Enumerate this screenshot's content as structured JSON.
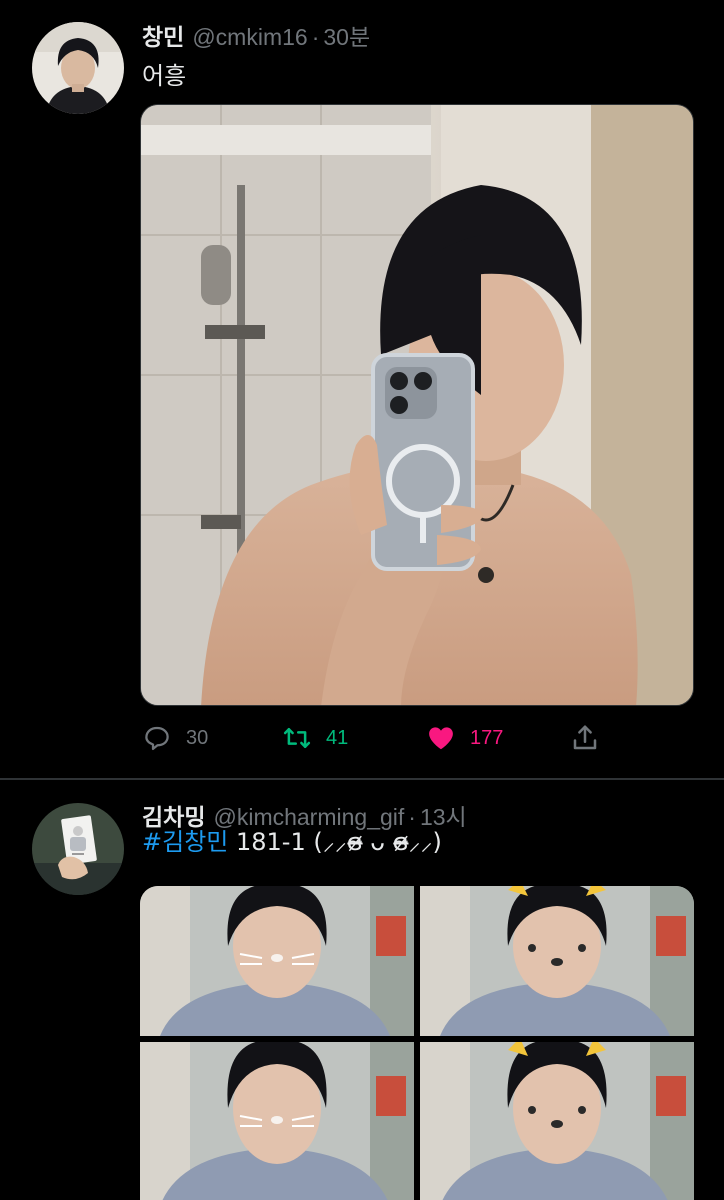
{
  "colors": {
    "background": "#000000",
    "text_primary": "#e7e9ea",
    "text_secondary": "#71767b",
    "hashtag": "#1d9bf0",
    "retweet": "#00ba7c",
    "like": "#f91880",
    "divider": "#2f3336"
  },
  "tweets": [
    {
      "display_name": "창민",
      "handle": "@cmkim16",
      "separator": "·",
      "time": "30분",
      "text": "어흥",
      "avatar": "profile-photo",
      "media": "mirror-selfie-photo",
      "actions": {
        "reply": {
          "icon": "reply-icon",
          "count": "30"
        },
        "retweet": {
          "icon": "retweet-icon",
          "count": "41"
        },
        "like": {
          "icon": "heart-icon",
          "count": "177",
          "liked": true
        },
        "share": {
          "icon": "share-icon"
        }
      }
    },
    {
      "display_name": "김차밍",
      "handle": "@kimcharming_gif",
      "separator": "·",
      "time": "13시",
      "hashtag": "#김창민",
      "text_rest": " 181-1 (⸝⸝ɞ̴̶̷ ᴗ ɞ̴̶̷⸝⸝)",
      "avatar": "photocard-photo",
      "media_grid": [
        "cat-filter-photo-1",
        "cat-filter-photo-2",
        "cat-filter-photo-3",
        "cat-filter-photo-4"
      ]
    }
  ]
}
